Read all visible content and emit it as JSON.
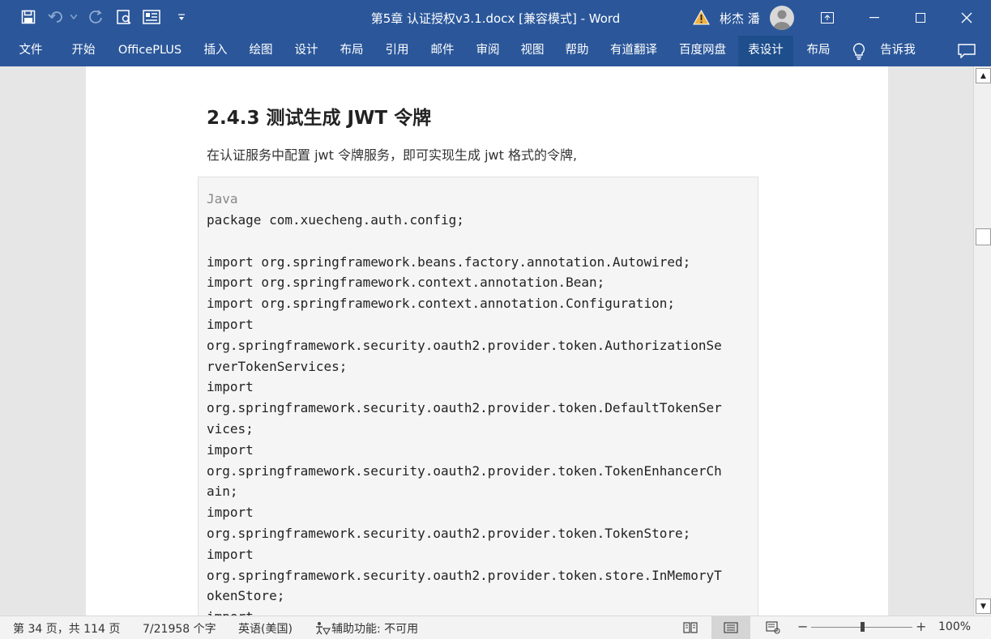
{
  "titlebar": {
    "title": "第5章 认证授权v3.1.docx [兼容模式]  -  Word",
    "user_name": "彬杰 潘"
  },
  "ribbon": {
    "tabs": [
      {
        "label": "文件"
      },
      {
        "label": "开始"
      },
      {
        "label": "OfficePLUS"
      },
      {
        "label": "插入"
      },
      {
        "label": "绘图"
      },
      {
        "label": "设计"
      },
      {
        "label": "布局"
      },
      {
        "label": "引用"
      },
      {
        "label": "邮件"
      },
      {
        "label": "审阅"
      },
      {
        "label": "视图"
      },
      {
        "label": "帮助"
      },
      {
        "label": "有道翻译"
      },
      {
        "label": "百度网盘"
      },
      {
        "label": "表设计"
      },
      {
        "label": "布局"
      }
    ],
    "active_tab": "表设计",
    "tell_me": "告诉我"
  },
  "document": {
    "heading": "2.4.3 测试生成 JWT 令牌",
    "paragraph": "在认证服务中配置 jwt 令牌服务，即可实现生成 jwt 格式的令牌,",
    "code_language": "Java",
    "code_lines": [
      "package com.xuecheng.auth.config;",
      "",
      "import org.springframework.beans.factory.annotation.Autowired;",
      "import org.springframework.context.annotation.Bean;",
      "import org.springframework.context.annotation.Configuration;",
      "import",
      "org.springframework.security.oauth2.provider.token.AuthorizationSe",
      "rverTokenServices;",
      "import",
      "org.springframework.security.oauth2.provider.token.DefaultTokenSer",
      "vices;",
      "import",
      "org.springframework.security.oauth2.provider.token.TokenEnhancerCh",
      "ain;",
      "import",
      "org.springframework.security.oauth2.provider.token.TokenStore;",
      "import",
      "org.springframework.security.oauth2.provider.token.store.InMemoryT",
      "okenStore;",
      "import"
    ]
  },
  "statusbar": {
    "page_info": "第 34 页，共 114 页",
    "word_count": "7/21958 个字",
    "language": "英语(美国)",
    "accessibility": "辅助功能: 不可用",
    "zoom_percent": "100%",
    "zoom_level": 1.0
  },
  "colors": {
    "ribbon_blue": "#2b579a",
    "active_tab": "#1e4e8c",
    "code_bg": "#f5f5f6"
  }
}
